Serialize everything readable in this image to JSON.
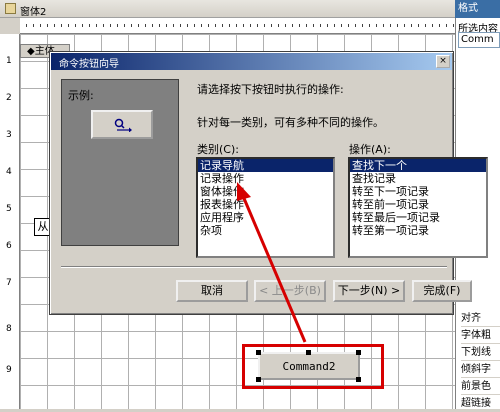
{
  "form": {
    "title": "窗体2",
    "section": "◆主体",
    "left_label": "从",
    "command_button": "Command2"
  },
  "properties": {
    "title": "格式",
    "subtitle": "所选内容",
    "combo_value": "Comm",
    "rows": [
      "对齐",
      "字体粗",
      "下划线",
      "倾斜字",
      "前景色",
      "超链接"
    ]
  },
  "dialog": {
    "title": "命令按钮向导",
    "close_label": "×",
    "sample_label": "示例:",
    "instruction": "请选择按下按钮时执行的操作:",
    "hint": "针对每一类别，可有多种不同的操作。",
    "categories_label": "类别(C):",
    "actions_label": "操作(A):",
    "categories": [
      {
        "label": "记录导航",
        "selected": true
      },
      {
        "label": "记录操作",
        "selected": false
      },
      {
        "label": "窗体操作",
        "selected": false
      },
      {
        "label": "报表操作",
        "selected": false
      },
      {
        "label": "应用程序",
        "selected": false
      },
      {
        "label": "杂项",
        "selected": false
      }
    ],
    "actions": [
      {
        "label": "查找下一个",
        "selected": true
      },
      {
        "label": "查找记录",
        "selected": false
      },
      {
        "label": "转至下一项记录",
        "selected": false
      },
      {
        "label": "转至前一项记录",
        "selected": false
      },
      {
        "label": "转至最后一项记录",
        "selected": false
      },
      {
        "label": "转至第一项记录",
        "selected": false
      }
    ],
    "buttons": {
      "cancel": "取消",
      "prev": "< 上一步(B)",
      "next": "下一步(N) >",
      "finish": "完成(F)"
    }
  },
  "ruler_numbers": [
    "1",
    "2",
    "3",
    "4",
    "5",
    "6",
    "7",
    "8",
    "9"
  ],
  "colors": {
    "title_active": "#0a246a",
    "selection": "#0a246a",
    "annotation_red": "#d60000",
    "dialog_face": "#d4d0c8"
  }
}
